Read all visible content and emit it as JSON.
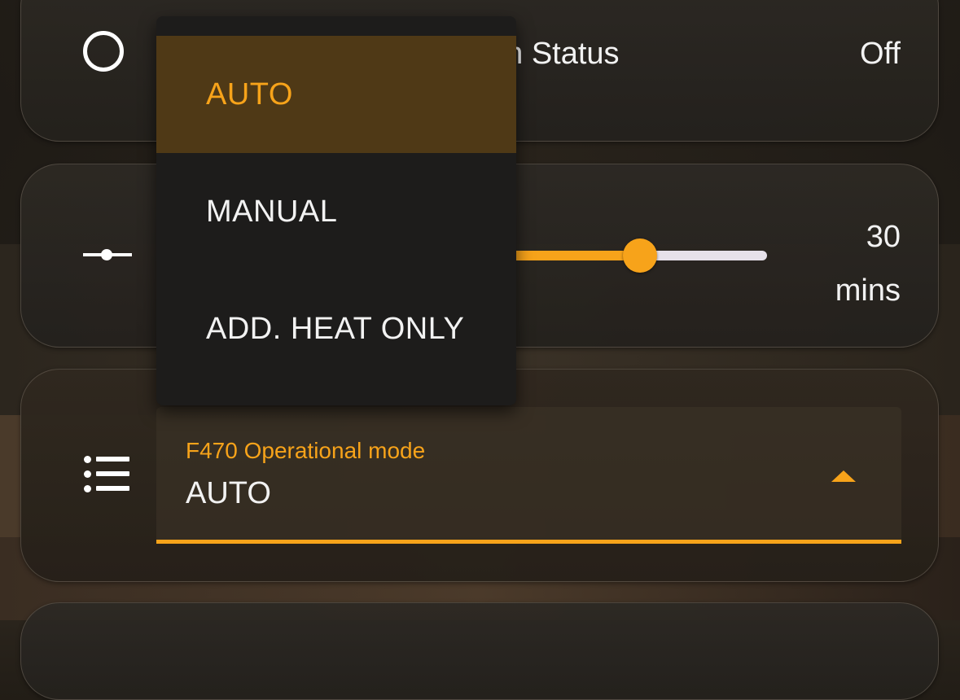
{
  "status_card": {
    "label": "on Status",
    "value": "Off",
    "icon": "circle-outline-icon"
  },
  "slider_card": {
    "icon": "slider-icon",
    "value_number": "30",
    "value_unit": "mins",
    "fill_fraction": 0.63,
    "accent_color": "#f7a31a",
    "track_color": "#e6e1ea"
  },
  "mode_card": {
    "icon": "list-icon",
    "field_label": "F470 Operational mode",
    "field_value": "AUTO",
    "arrow_icon": "caret-up-icon"
  },
  "dropdown": {
    "options": [
      {
        "label": "AUTO",
        "selected": true
      },
      {
        "label": "MANUAL",
        "selected": false
      },
      {
        "label": "ADD. HEAT ONLY",
        "selected": false
      }
    ]
  },
  "colors": {
    "accent": "#f7a31a",
    "selected_bg": "#4f3916",
    "menu_bg": "#1d1c1b",
    "text": "#f2f2f2"
  }
}
